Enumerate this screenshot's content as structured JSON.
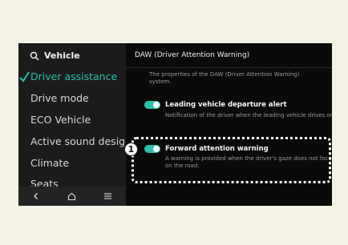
{
  "sidebar": {
    "header": "Vehicle",
    "items": [
      {
        "label": "Driver assistance",
        "active": true
      },
      {
        "label": "Drive mode",
        "active": false
      },
      {
        "label": "ECO Vehicle",
        "active": false
      },
      {
        "label": "Active sound design",
        "active": false
      },
      {
        "label": "Climate",
        "active": false
      },
      {
        "label": "Seats",
        "active": false
      }
    ]
  },
  "panel": {
    "title": "DAW (Driver Attention Warning)",
    "description": "The properties of the DAW (Driver Attention Warning) system.",
    "options": [
      {
        "title": "Leading vehicle departure alert",
        "description": "Notification of the driver when the leading vehicle drives on.",
        "enabled": true
      },
      {
        "title": "Forward attention warning",
        "description": "A warning is provided when the driver's gaze does not focus on the road.",
        "enabled": true
      }
    ]
  },
  "callout": "1",
  "colors": {
    "accent": "#2fbfa9",
    "screen_bg": "#0a0a0a",
    "page_bg": "#f4f1e6"
  },
  "icons": [
    "search-icon",
    "checkmark-icon",
    "back-icon",
    "home-icon",
    "menu-icon"
  ]
}
